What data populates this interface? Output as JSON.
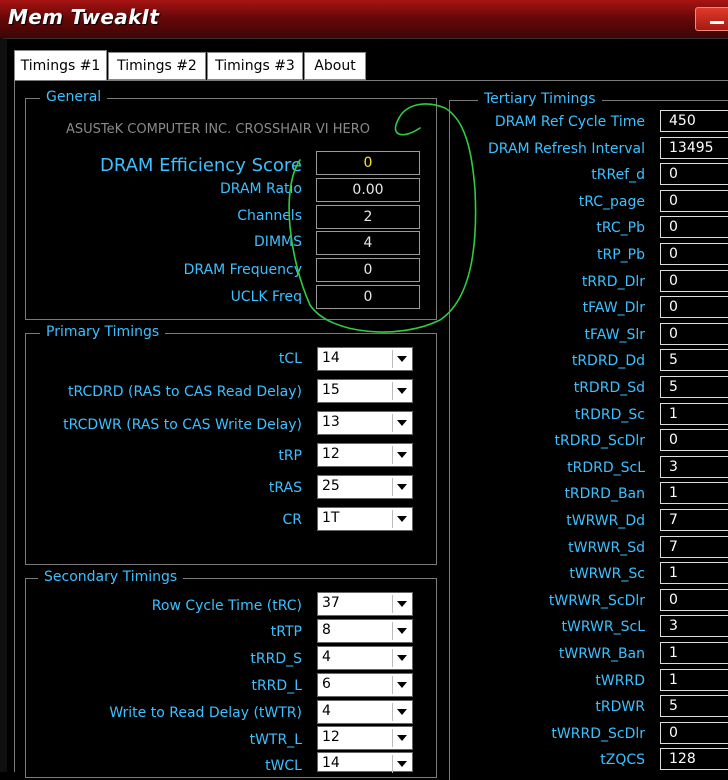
{
  "window": {
    "title": "Mem TweakIt",
    "minimize_icon": "minimize-icon"
  },
  "tabs": [
    {
      "label": "Timings #1",
      "active": true
    },
    {
      "label": "Timings #2",
      "active": false
    },
    {
      "label": "Timings #3",
      "active": false
    },
    {
      "label": "About",
      "active": false
    }
  ],
  "general": {
    "legend": "General",
    "board": "ASUSTeK COMPUTER INC. CROSSHAIR VI HERO",
    "efficiency_label": "DRAM Efficiency Score",
    "efficiency_value": "0",
    "rows": [
      {
        "label": "DRAM Ratio",
        "value": "0.00"
      },
      {
        "label": "Channels",
        "value": "2"
      },
      {
        "label": "DIMMS",
        "value": "4"
      },
      {
        "label": "DRAM Frequency",
        "value": "0"
      },
      {
        "label": "UCLK Freq",
        "value": "0"
      }
    ]
  },
  "primary": {
    "legend": "Primary Timings",
    "rows": [
      {
        "label": "tCL",
        "value": "14"
      },
      {
        "label": "tRCDRD (RAS to CAS Read Delay)",
        "value": "15"
      },
      {
        "label": "tRCDWR (RAS to CAS Write Delay)",
        "value": "13"
      },
      {
        "label": "tRP",
        "value": "12"
      },
      {
        "label": "tRAS",
        "value": "25"
      },
      {
        "label": "CR",
        "value": "1T"
      }
    ]
  },
  "secondary": {
    "legend": "Secondary Timings",
    "rows": [
      {
        "label": "Row Cycle Time (tRC)",
        "value": "37"
      },
      {
        "label": "tRTP",
        "value": "8"
      },
      {
        "label": "tRRD_S",
        "value": "4"
      },
      {
        "label": "tRRD_L",
        "value": "6"
      },
      {
        "label": "Write to Read Delay (tWTR)",
        "value": "4"
      },
      {
        "label": "tWTR_L",
        "value": "12"
      },
      {
        "label": "tWCL",
        "value": "14"
      }
    ]
  },
  "tertiary": {
    "legend": "Tertiary Timings",
    "rows": [
      {
        "label": "DRAM Ref Cycle Time",
        "value": "450"
      },
      {
        "label": "DRAM Refresh Interval",
        "value": "13495"
      },
      {
        "label": "tRRef_d",
        "value": "0"
      },
      {
        "label": "tRC_page",
        "value": "0"
      },
      {
        "label": "tRC_Pb",
        "value": "0"
      },
      {
        "label": "tRP_Pb",
        "value": "0"
      },
      {
        "label": "tRRD_Dlr",
        "value": "0"
      },
      {
        "label": "tFAW_Dlr",
        "value": "0"
      },
      {
        "label": "tFAW_Slr",
        "value": "0"
      },
      {
        "label": "tRDRD_Dd",
        "value": "5"
      },
      {
        "label": "tRDRD_Sd",
        "value": "5"
      },
      {
        "label": "tRDRD_Sc",
        "value": "1"
      },
      {
        "label": "tRDRD_ScDlr",
        "value": "0"
      },
      {
        "label": "tRDRD_ScL",
        "value": "3"
      },
      {
        "label": "tRDRD_Ban",
        "value": "1"
      },
      {
        "label": "tWRWR_Dd",
        "value": "7"
      },
      {
        "label": "tWRWR_Sd",
        "value": "7"
      },
      {
        "label": "tWRWR_Sc",
        "value": "1"
      },
      {
        "label": "tWRWR_ScDlr",
        "value": "0"
      },
      {
        "label": "tWRWR_ScL",
        "value": "3"
      },
      {
        "label": "tWRWR_Ban",
        "value": "1"
      },
      {
        "label": "tWRRD",
        "value": "1"
      },
      {
        "label": "tRDWR",
        "value": "5"
      },
      {
        "label": "tWRRD_ScDlr",
        "value": "0"
      },
      {
        "label": "tZQCS",
        "value": "128"
      }
    ]
  },
  "colors": {
    "label": "#3cc0ff",
    "efficiency": "#ffe22a",
    "annotation": "#2ecc40",
    "titlebar": "#8a0e0e"
  }
}
